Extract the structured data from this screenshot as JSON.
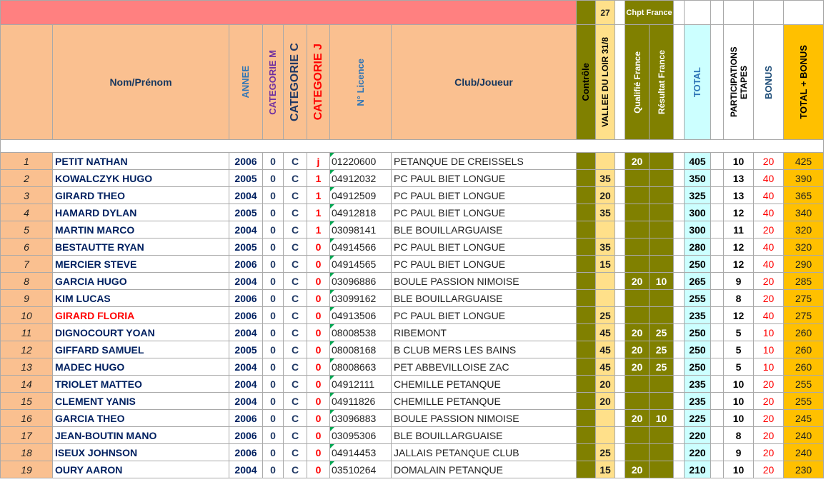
{
  "header": {
    "top_count": "27",
    "chpt_france": "Chpt France",
    "nom_prenom": "Nom/Prénom",
    "annee": "ANNEE",
    "categorie_m": "CATEGORIE M",
    "categorie_c": "CATEGORIE C",
    "categorie_j": "CATEGORIE J",
    "licence": "N° Licence",
    "club": "Club/Joueur",
    "controle": "Contrôle",
    "vallee": "VALLEE DU LOIR 31/8",
    "qualifie": "Qualifié France",
    "resultat": "Résultat France",
    "total": "TOTAL",
    "participations": "PARTICIPATIONS ETAPES",
    "bonus": "BONUS",
    "total_bonus": "TOTAL + BONUS"
  },
  "rows": [
    {
      "rank": "1",
      "name": "PETIT NATHAN",
      "year": "2006",
      "m": "0",
      "c": "C",
      "j": "j",
      "licence": "01220600",
      "club": "PETANQUE DE CREISSELS",
      "vallee": "",
      "qual": "20",
      "res": "",
      "total": "405",
      "part": "10",
      "bonus": "20",
      "grand": "425",
      "name_red": false
    },
    {
      "rank": "2",
      "name": "KOWALCZYK HUGO",
      "year": "2005",
      "m": "0",
      "c": "C",
      "j": "1",
      "licence": "04912032",
      "club": "PC PAUL BIET LONGUE",
      "vallee": "35",
      "qual": "",
      "res": "",
      "total": "350",
      "part": "13",
      "bonus": "40",
      "grand": "390",
      "name_red": false
    },
    {
      "rank": "3",
      "name": "GIRARD THEO",
      "year": "2004",
      "m": "0",
      "c": "C",
      "j": "1",
      "licence": "04912509",
      "club": "PC PAUL BIET LONGUE",
      "vallee": "20",
      "qual": "",
      "res": "",
      "total": "325",
      "part": "13",
      "bonus": "40",
      "grand": "365",
      "name_red": false
    },
    {
      "rank": "4",
      "name": "HAMARD DYLAN",
      "year": "2005",
      "m": "0",
      "c": "C",
      "j": "1",
      "licence": "04912818",
      "club": "PC PAUL BIET LONGUE",
      "vallee": "35",
      "qual": "",
      "res": "",
      "total": "300",
      "part": "12",
      "bonus": "40",
      "grand": "340",
      "name_red": false
    },
    {
      "rank": "5",
      "name": "MARTIN MARCO",
      "year": "2004",
      "m": "0",
      "c": "C",
      "j": "1",
      "licence": "03098141",
      "club": "BLE BOUILLARGUAISE",
      "vallee": "",
      "qual": "",
      "res": "",
      "total": "300",
      "part": "11",
      "bonus": "20",
      "grand": "320",
      "name_red": false
    },
    {
      "rank": "6",
      "name": "BESTAUTTE RYAN",
      "year": "2005",
      "m": "0",
      "c": "C",
      "j": "0",
      "licence": "04914566",
      "club": "PC PAUL BIET LONGUE",
      "vallee": "35",
      "qual": "",
      "res": "",
      "total": "280",
      "part": "12",
      "bonus": "40",
      "grand": "320",
      "name_red": false
    },
    {
      "rank": "7",
      "name": "MERCIER STEVE",
      "year": "2006",
      "m": "0",
      "c": "C",
      "j": "0",
      "licence": "04914565",
      "club": "PC PAUL BIET LONGUE",
      "vallee": "15",
      "qual": "",
      "res": "",
      "total": "250",
      "part": "12",
      "bonus": "40",
      "grand": "290",
      "name_red": false
    },
    {
      "rank": "8",
      "name": "GARCIA HUGO",
      "year": "2004",
      "m": "0",
      "c": "C",
      "j": "0",
      "licence": "03096886",
      "club": "BOULE PASSION NIMOISE",
      "vallee": "",
      "qual": "20",
      "res": "10",
      "total": "265",
      "part": "9",
      "bonus": "20",
      "grand": "285",
      "name_red": false
    },
    {
      "rank": "9",
      "name": "KIM LUCAS",
      "year": "2006",
      "m": "0",
      "c": "C",
      "j": "0",
      "licence": "03099162",
      "club": "BLE BOUILLARGUAISE",
      "vallee": "",
      "qual": "",
      "res": "",
      "total": "255",
      "part": "8",
      "bonus": "20",
      "grand": "275",
      "name_red": false
    },
    {
      "rank": "10",
      "name": "GIRARD FLORIA",
      "year": "2006",
      "m": "0",
      "c": "C",
      "j": "0",
      "licence": "04913506",
      "club": "PC PAUL BIET LONGUE",
      "vallee": "25",
      "qual": "",
      "res": "",
      "total": "235",
      "part": "12",
      "bonus": "40",
      "grand": "275",
      "name_red": true
    },
    {
      "rank": "11",
      "name": "DIGNOCOURT YOAN",
      "year": "2004",
      "m": "0",
      "c": "C",
      "j": "0",
      "licence": "08008538",
      "club": "RIBEMONT",
      "vallee": "45",
      "qual": "20",
      "res": "25",
      "total": "250",
      "part": "5",
      "bonus": "10",
      "grand": "260",
      "name_red": false
    },
    {
      "rank": "12",
      "name": "GIFFARD SAMUEL",
      "year": "2005",
      "m": "0",
      "c": "C",
      "j": "0",
      "licence": "08008168",
      "club": "B CLUB MERS LES BAINS",
      "vallee": "45",
      "qual": "20",
      "res": "25",
      "total": "250",
      "part": "5",
      "bonus": "10",
      "grand": "260",
      "name_red": false
    },
    {
      "rank": "13",
      "name": "MADEC HUGO",
      "year": "2004",
      "m": "0",
      "c": "C",
      "j": "0",
      "licence": "08008663",
      "club": "PET ABBEVILLOISE ZAC",
      "vallee": "45",
      "qual": "20",
      "res": "25",
      "total": "250",
      "part": "5",
      "bonus": "10",
      "grand": "260",
      "name_red": false
    },
    {
      "rank": "14",
      "name": "TRIOLET MATTEO",
      "year": "2004",
      "m": "0",
      "c": "C",
      "j": "0",
      "licence": "04912111",
      "club": "CHEMILLE PETANQUE",
      "vallee": "20",
      "qual": "",
      "res": "",
      "total": "235",
      "part": "10",
      "bonus": "20",
      "grand": "255",
      "name_red": false
    },
    {
      "rank": "15",
      "name": "CLEMENT YANIS",
      "year": "2004",
      "m": "0",
      "c": "C",
      "j": "0",
      "licence": "04911826",
      "club": "CHEMILLE PETANQUE",
      "vallee": "20",
      "qual": "",
      "res": "",
      "total": "235",
      "part": "10",
      "bonus": "20",
      "grand": "255",
      "name_red": false
    },
    {
      "rank": "16",
      "name": "GARCIA THEO",
      "year": "2006",
      "m": "0",
      "c": "C",
      "j": "0",
      "licence": "03096883",
      "club": "BOULE PASSION NIMOISE",
      "vallee": "",
      "qual": "20",
      "res": "10",
      "total": "225",
      "part": "10",
      "bonus": "20",
      "grand": "245",
      "name_red": false
    },
    {
      "rank": "17",
      "name": "JEAN-BOUTIN MANO",
      "year": "2006",
      "m": "0",
      "c": "C",
      "j": "0",
      "licence": "03095306",
      "club": "BLE BOUILLARGUAISE",
      "vallee": "",
      "qual": "",
      "res": "",
      "total": "220",
      "part": "8",
      "bonus": "20",
      "grand": "240",
      "name_red": false
    },
    {
      "rank": "18",
      "name": "ISEUX JOHNSON",
      "year": "2006",
      "m": "0",
      "c": "C",
      "j": "0",
      "licence": "04914453",
      "club": "JALLAIS PETANQUE CLUB",
      "vallee": "25",
      "qual": "",
      "res": "",
      "total": "220",
      "part": "9",
      "bonus": "20",
      "grand": "240",
      "name_red": false
    },
    {
      "rank": "19",
      "name": "OURY AARON",
      "year": "2004",
      "m": "0",
      "c": "C",
      "j": "0",
      "licence": "03510264",
      "club": "DOMALAIN PETANQUE",
      "vallee": "15",
      "qual": "20",
      "res": "",
      "total": "210",
      "part": "10",
      "bonus": "20",
      "grand": "230",
      "name_red": false
    }
  ]
}
